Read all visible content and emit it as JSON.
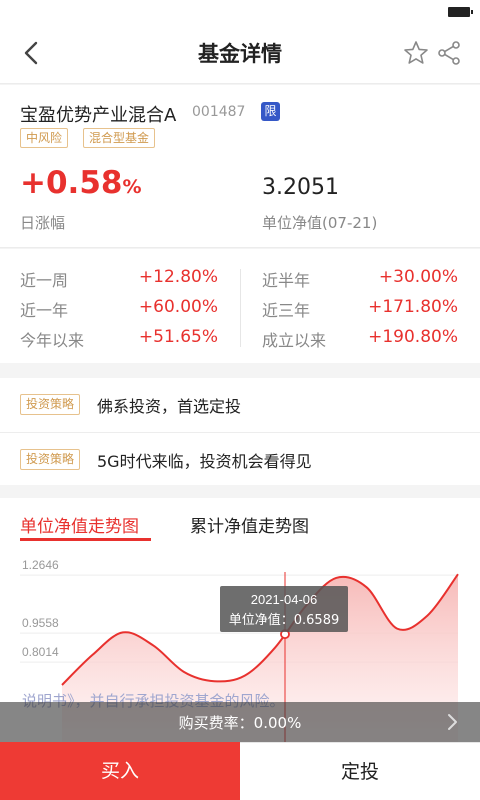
{
  "nav": {
    "title": "基金详情",
    "icons": [
      "back-arrow-icon",
      "star-icon",
      "share-icon"
    ]
  },
  "fund": {
    "name": "宝盈优势产业混合A",
    "code": "001487",
    "limit_badge": "限",
    "tags": [
      "中风险",
      "混合型基金"
    ],
    "day_change_value": "+0.58",
    "day_change_unit": "%",
    "day_change_label": "日涨幅",
    "nav_value": "3.2051",
    "nav_label": "单位净值(07-21)"
  },
  "performance": [
    {
      "label": "近一周",
      "value": "+12.80%"
    },
    {
      "label": "近半年",
      "value": "+30.00%"
    },
    {
      "label": "近一年",
      "value": "+60.00%"
    },
    {
      "label": "近三年",
      "value": "+171.80%"
    },
    {
      "label": "今年以来",
      "value": "+51.65%"
    },
    {
      "label": "成立以来",
      "value": "+190.80%"
    }
  ],
  "strategies": [
    {
      "tag": "投资策略",
      "text": "佛系投资，首选定投"
    },
    {
      "tag": "投资策略",
      "text": "5G时代来临，投资机会看得见"
    }
  ],
  "chart": {
    "tabs": [
      "单位净值走势图",
      "累计净值走势图"
    ],
    "active_tab": 0,
    "y_ticks": [
      "1.2646",
      "0.9558",
      "0.8014"
    ],
    "tooltip_date": "2021-04-06",
    "tooltip_label": "单位净值：",
    "tooltip_value": "0.6589",
    "behind_text": "说明书》，并自行承担投资基金的风险。",
    "colors": {
      "line": "#e8312e",
      "area_top": "#f6b3b1",
      "area_bottom": "#fff3f3"
    }
  },
  "chart_data": {
    "type": "area",
    "title": "单位净值走势图",
    "xlabel": "",
    "ylabel": "",
    "y_tick_values": [
      1.2646,
      0.9558,
      0.8014
    ],
    "series": [
      {
        "values": [
          0.68,
          0.84,
          0.96,
          0.89,
          0.75,
          0.7,
          0.73,
          0.88,
          1.1,
          1.25,
          1.2,
          0.98,
          1.05,
          1.27
        ]
      }
    ],
    "highlight": {
      "x": "2021-04-06",
      "y": 0.6589
    },
    "grid": true,
    "legend": "none"
  },
  "footer": {
    "fee_text": "购买费率：0.00%",
    "buy_label": "买入",
    "plan_label": "定投"
  },
  "colors": {
    "rise_red": "#e8312e",
    "tag_gold": "#d09a4f",
    "badge_blue": "#3558c7",
    "buy_red": "#ee3a34"
  }
}
